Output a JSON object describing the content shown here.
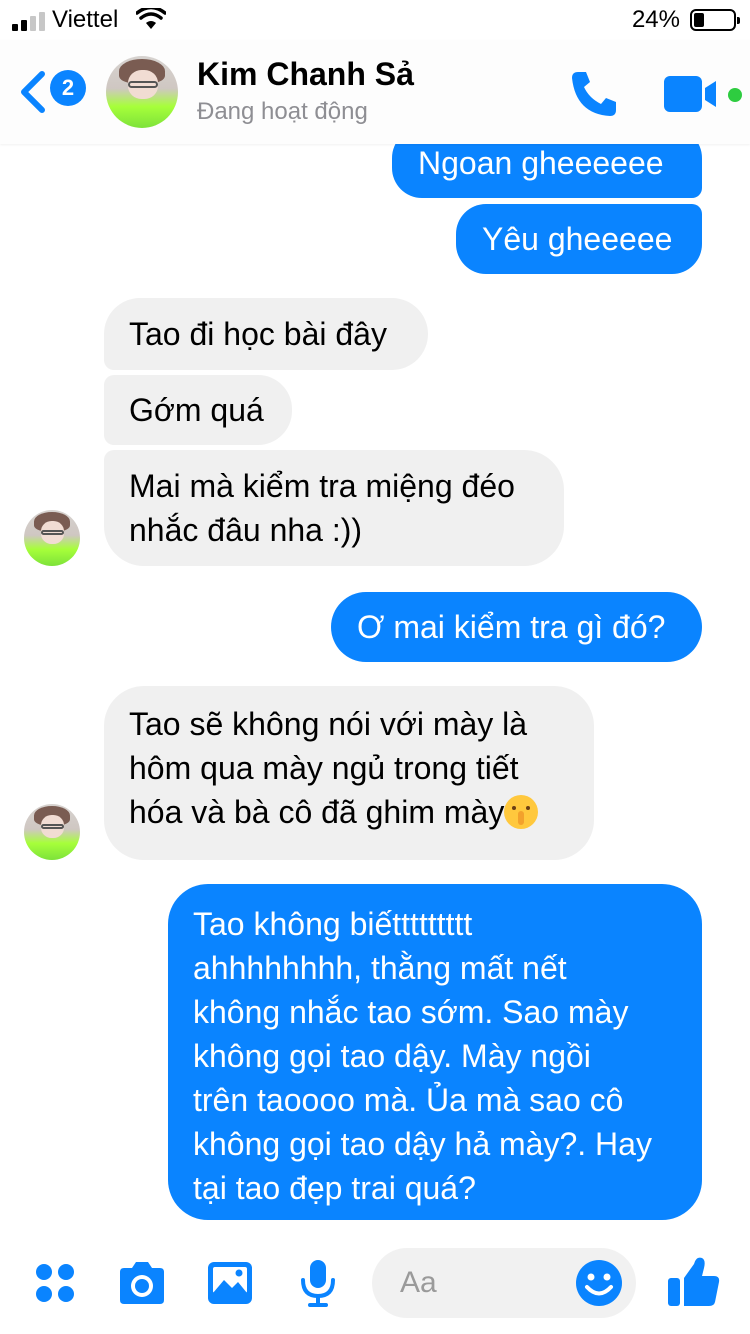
{
  "status_bar": {
    "carrier": "Viettel",
    "battery_pct": "24%",
    "battery_level": 0.24
  },
  "header": {
    "back_badge": "2",
    "contact_name": "Kim Chanh Sả",
    "contact_status": "Đang hoạt động",
    "icons": [
      "back-chevron-icon",
      "phone-icon",
      "video-camera-icon"
    ],
    "online_color": "#2ecc40"
  },
  "messages": [
    {
      "from": "me",
      "text": "Ngoan gheeeeee"
    },
    {
      "from": "me",
      "text": "Yêu gheeeee"
    },
    {
      "from": "them",
      "text": "Tao đi học bài đây"
    },
    {
      "from": "them",
      "text": "Gớm quá"
    },
    {
      "from": "them",
      "lines": [
        "Mai mà kiểm tra miệng đéo",
        "nhắc đâu nha :))"
      ]
    },
    {
      "from": "me",
      "text": "Ơ mai kiểm tra gì đó?"
    },
    {
      "from": "them",
      "lines": [
        "Tao sẽ không nói với mày là",
        "hôm qua mày ngủ trong tiết",
        "hóa và bà cô đã ghim mày"
      ],
      "emoji": "shushing-face-emoji"
    },
    {
      "from": "me",
      "lines": [
        "Tao không biếttttttttt",
        "ahhhhhhhh, thằng mất nết",
        "không nhắc tao sớm. Sao mày",
        "không gọi tao dậy. Mày ngồi",
        "trên taoooo mà. Ủa mà sao cô",
        "không gọi tao dậy hả mày?. Hay",
        "tại tao đẹp trai quá?"
      ]
    }
  ],
  "composer": {
    "placeholder": "Aa",
    "icons": [
      "apps-grid-icon",
      "camera-icon",
      "photo-icon",
      "microphone-icon",
      "emoji-smile-icon",
      "thumbs-up-icon"
    ]
  },
  "colors": {
    "accent": "#0a84ff",
    "incoming_bubble": "#f0f0f0"
  }
}
